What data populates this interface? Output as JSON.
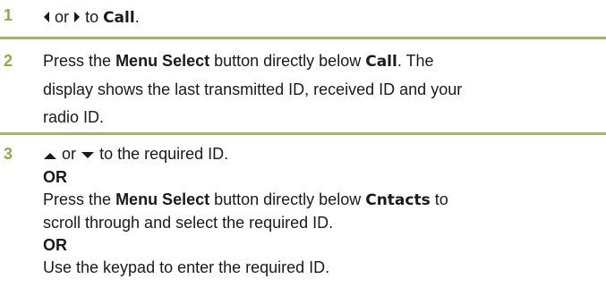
{
  "colors": {
    "accent": "#8aae3f",
    "rule": "#9bbb59",
    "text": "#1a1a1a"
  },
  "step1": {
    "number": "1",
    "or": "or",
    "to": "to",
    "display_word": "Call",
    "end": ".",
    "icons": [
      "left-arrow-icon",
      "right-arrow-icon"
    ]
  },
  "step2": {
    "number": "2",
    "prefix": "Press the",
    "button_name": "Menu Select",
    "mid": "button directly below",
    "display_word": "Call",
    "line1_end": ". The",
    "line2": "display shows the last transmitted ID, received ID and your",
    "line3": "radio ID."
  },
  "step3": {
    "number": "3",
    "or": "or",
    "rest": "to the required ID.",
    "or_heading": "OR",
    "prefix": "Press the",
    "button_name": "Menu Select",
    "mid": "button directly below",
    "display_word": "Cntacts",
    "line_end": "to",
    "line2": "scroll through and select the required ID.",
    "or_heading_2": "OR",
    "line3": "Use the keypad to enter the required ID.",
    "icons": [
      "up-arrow-icon",
      "down-arrow-icon"
    ]
  }
}
